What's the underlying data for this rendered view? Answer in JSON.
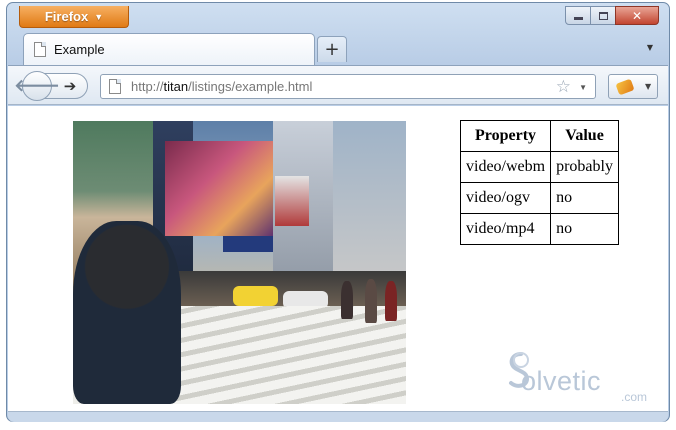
{
  "browser": {
    "menu_button_label": "Firefox",
    "window_controls": {
      "minimize": "minimize-icon",
      "maximize": "maximize-icon",
      "close": "✕"
    }
  },
  "tabs": [
    {
      "label": "Example",
      "icon": "page-icon",
      "active": true
    }
  ],
  "new_tab_label": "+",
  "navigation": {
    "back_icon": "arrow-left-icon",
    "forward_icon": "arrow-right-icon",
    "url_prefix": "http://",
    "url_host": "titan",
    "url_path": "/listings/example.html",
    "bookmark_icon": "star-icon"
  },
  "page": {
    "video": {
      "description_icon": "video-frame"
    },
    "table": {
      "headers": [
        "Property",
        "Value"
      ],
      "rows": [
        [
          "video/webm",
          "probably"
        ],
        [
          "video/ogv",
          "no"
        ],
        [
          "video/mp4",
          "no"
        ]
      ]
    }
  },
  "watermark": {
    "brand": "olvetic",
    "suffix": ".com"
  },
  "colors": {
    "firefox_orange": "#e07a14",
    "chrome_blue": "#b9cde6",
    "close_red": "#c24530"
  }
}
